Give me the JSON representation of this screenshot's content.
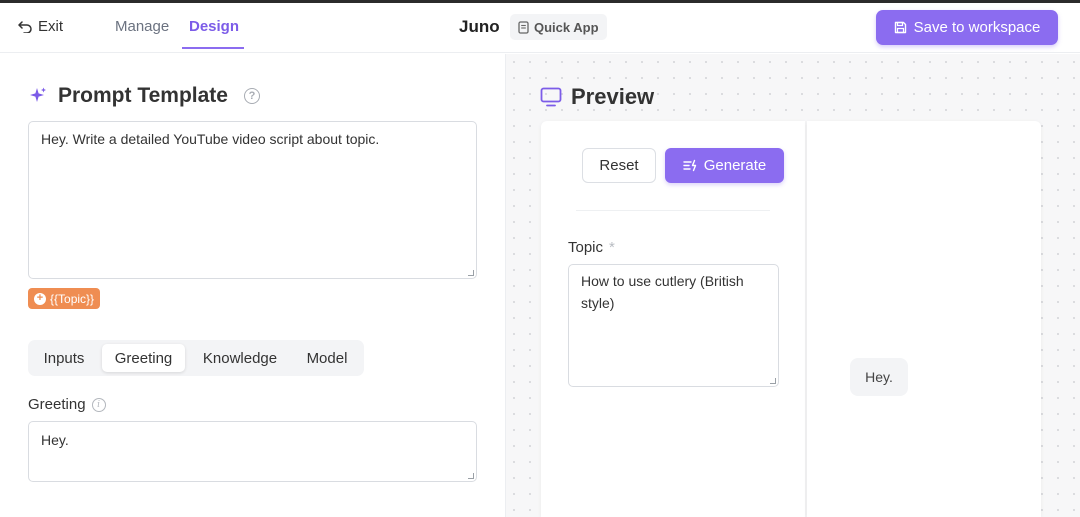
{
  "header": {
    "exit_label": "Exit",
    "tabs": [
      {
        "label": "Manage",
        "active": false
      },
      {
        "label": "Design",
        "active": true
      }
    ],
    "app_name": "Juno",
    "badge_label": "Quick App",
    "save_label": "Save to workspace"
  },
  "prompt_template": {
    "title": "Prompt Template",
    "help_icon": "question-circle-icon",
    "text": "Hey. Write a detailed YouTube video script about topic.",
    "variable_chip": "{{Topic}}"
  },
  "settings_tabs": [
    {
      "label": "Inputs",
      "active": false
    },
    {
      "label": "Greeting",
      "active": true
    },
    {
      "label": "Knowledge",
      "active": false
    },
    {
      "label": "Model",
      "active": false
    }
  ],
  "greeting": {
    "label": "Greeting",
    "value": "Hey."
  },
  "preview": {
    "title": "Preview",
    "reset_label": "Reset",
    "generate_label": "Generate",
    "topic_label": "Topic",
    "required_mark": "*",
    "topic_value": "How to use cutlery (British style)",
    "chat_message": "Hey."
  },
  "colors": {
    "accent": "#8b6cf0",
    "chip": "#ef8d52"
  }
}
